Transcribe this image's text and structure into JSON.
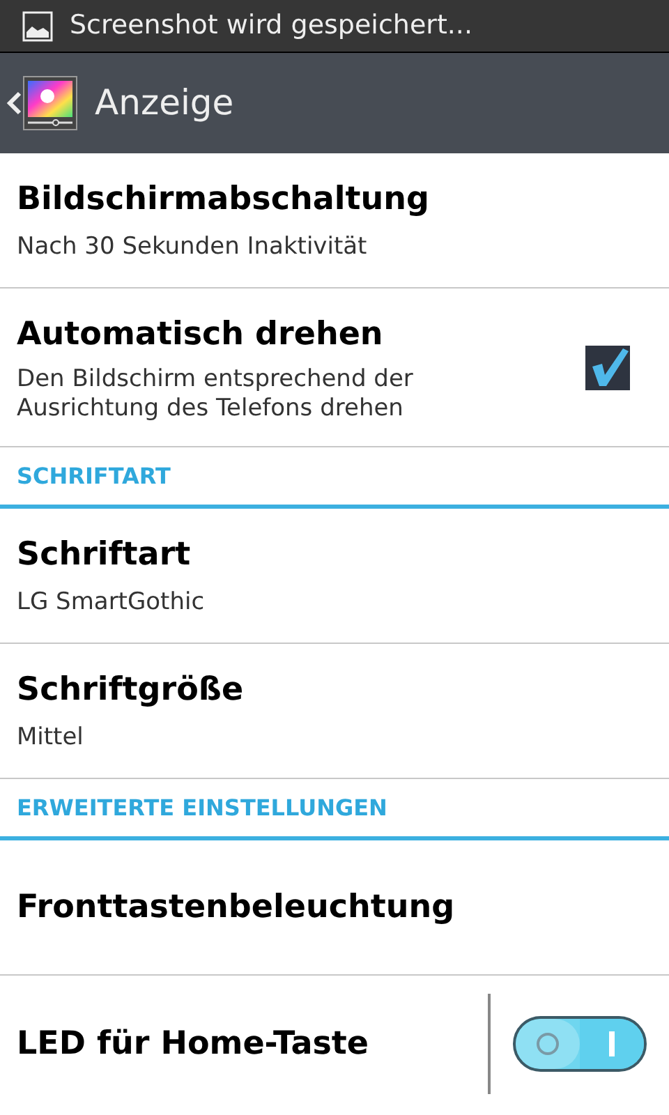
{
  "status_bar": {
    "notification": "Screenshot wird gespeichert..."
  },
  "header": {
    "title": "Anzeige"
  },
  "list": [
    {
      "kind": "item",
      "title": "Bildschirmabschaltung",
      "summary": "Nach 30 Sekunden Inaktivität"
    },
    {
      "kind": "checkbox",
      "title": "Automatisch drehen",
      "summary": "Den Bildschirm entsprechend der Ausrichtung des Telefons drehen",
      "checked": true
    },
    {
      "kind": "section",
      "title": "SCHRIFTART"
    },
    {
      "kind": "item",
      "title": "Schriftart",
      "summary": "LG SmartGothic"
    },
    {
      "kind": "item",
      "title": "Schriftgröße",
      "summary": "Mittel"
    },
    {
      "kind": "section",
      "title": "ERWEITERTE EINSTELLUNGEN"
    },
    {
      "kind": "item",
      "title": "Fronttastenbeleuchtung"
    },
    {
      "kind": "switch",
      "title": "LED für Home-Taste",
      "on": true
    }
  ]
}
